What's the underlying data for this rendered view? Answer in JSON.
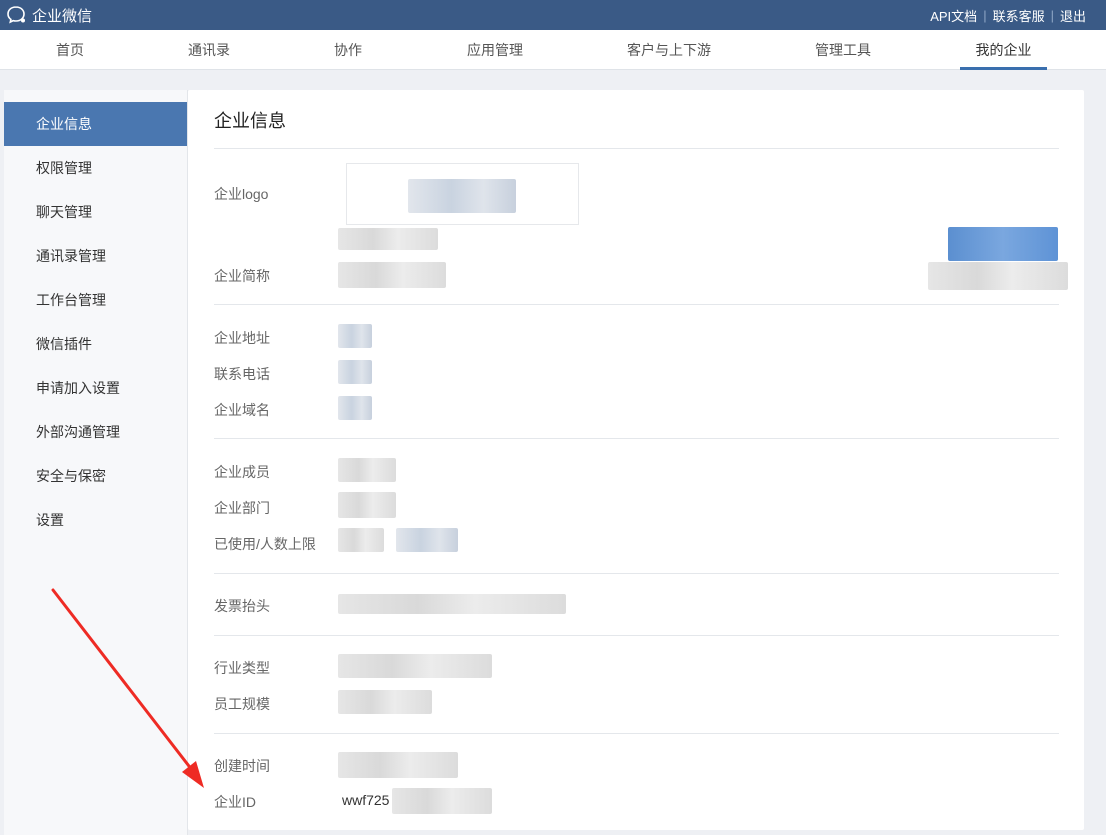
{
  "topbar": {
    "brand": "企业微信",
    "links": [
      "API文档",
      "联系客服",
      "退出"
    ],
    "separator": "|"
  },
  "nav": {
    "tabs": [
      "首页",
      "通讯录",
      "协作",
      "应用管理",
      "客户与上下游",
      "管理工具",
      "我的企业"
    ],
    "active_index": 6
  },
  "sidebar": {
    "items": [
      "企业信息",
      "权限管理",
      "聊天管理",
      "通讯录管理",
      "工作台管理",
      "微信插件",
      "申请加入设置",
      "外部沟通管理",
      "安全与保密",
      "设置"
    ],
    "active_index": 0
  },
  "panel": {
    "title": "企业信息",
    "labels": {
      "logo": "企业logo",
      "short_name": "企业简称",
      "address": "企业地址",
      "phone": "联系电话",
      "domain": "企业域名",
      "members": "企业成员",
      "departments": "企业部门",
      "usage": "已使用/人数上限",
      "invoice": "发票抬头",
      "industry": "行业类型",
      "scale": "员工规模",
      "created": "创建时间",
      "corp_id": "企业ID"
    },
    "corp_id_prefix": "wwf725"
  },
  "colors": {
    "topbar": "#3a5a86",
    "accent": "#4a77b0",
    "arrow": "#ee2b24"
  }
}
